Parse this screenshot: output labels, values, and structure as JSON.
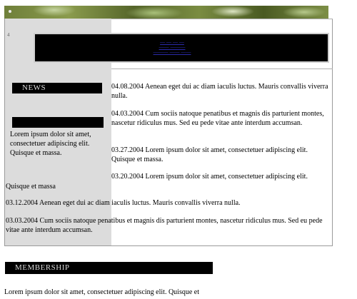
{
  "header": {
    "link_lines": [
      "— — — —",
      "—— ———",
      "——— —— ——"
    ]
  },
  "sidebar": {
    "news_title": "NEWS",
    "second_title": "",
    "text": "Lorem ipsum dolor sit amet, consectetuer adipiscing elit. Quisque et massa.",
    "trailing_text": "Quisque et massa"
  },
  "news": [
    {
      "date": "04.08.2004",
      "text": "Aenean eget dui ac diam iaculis luctus. Mauris convallis viverra nulla."
    },
    {
      "date": "04.03.2004",
      "text": "Cum sociis natoque penatibus et magnis dis parturient montes, nascetur ridiculus mus. Sed eu pede vitae ante interdum accumsan."
    },
    {
      "date": "03.27.2004",
      "text": "Lorem ipsum dolor sit amet, consectetuer adipiscing elit. Quisque et massa."
    },
    {
      "date": "03.20.2004",
      "text": "Lorem ipsum dolor sit amet, consectetuer adipiscing elit."
    },
    {
      "date": "03.12.2004",
      "text": "Aenean eget dui ac diam iaculis luctus. Mauris convallis viverra nulla."
    },
    {
      "date": "03.03.2004",
      "text": "Cum sociis natoque penatibus et magnis dis parturient montes, nascetur ridiculus mus. Sed eu pede vitae ante interdum accumsan."
    }
  ],
  "membership": {
    "title": "MEMBERSHIP",
    "text": "Lorem ipsum dolor sit amet, consectetuer adipiscing elit. Quisque et"
  }
}
